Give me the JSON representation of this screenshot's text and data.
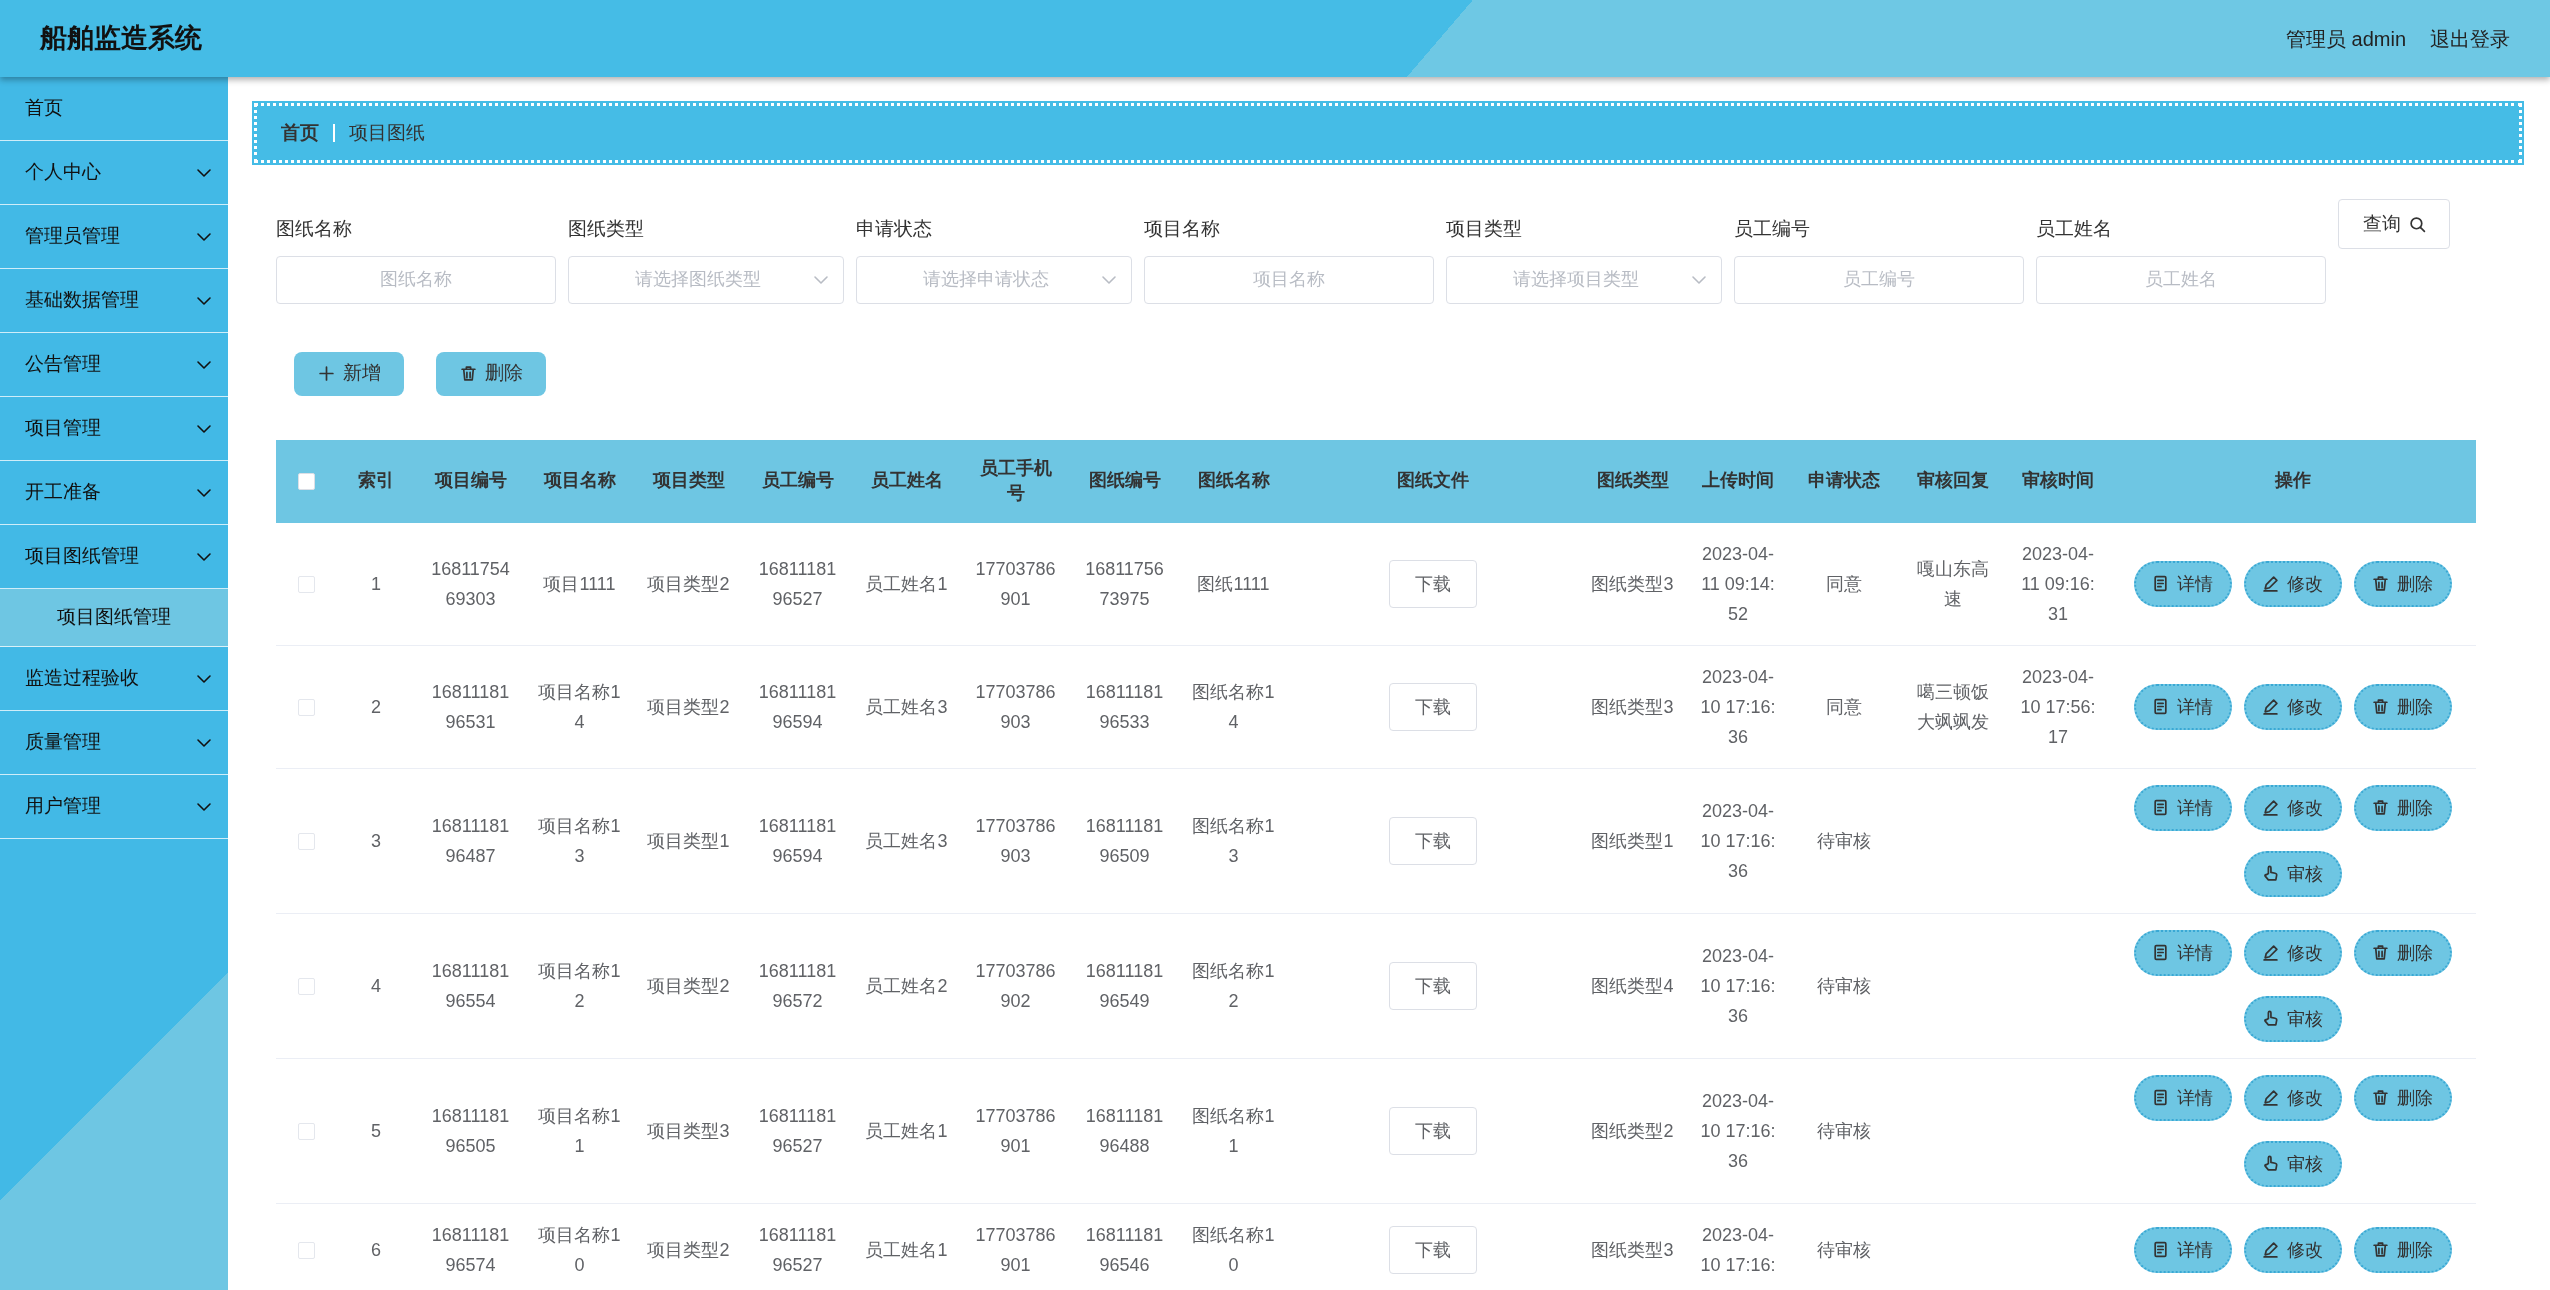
{
  "app": {
    "title": "船舶监造系统",
    "user": "管理员 admin",
    "logout": "退出登录"
  },
  "sidebar": {
    "items": [
      {
        "label": "首页",
        "kind": "link"
      },
      {
        "label": "个人中心",
        "kind": "menu"
      },
      {
        "label": "管理员管理",
        "kind": "menu"
      },
      {
        "label": "基础数据管理",
        "kind": "menu"
      },
      {
        "label": "公告管理",
        "kind": "menu"
      },
      {
        "label": "项目管理",
        "kind": "menu"
      },
      {
        "label": "开工准备",
        "kind": "menu"
      },
      {
        "label": "项目图纸管理",
        "kind": "menu",
        "children": [
          {
            "label": "项目图纸管理"
          }
        ]
      },
      {
        "label": "监造过程验收",
        "kind": "menu"
      },
      {
        "label": "质量管理",
        "kind": "menu"
      },
      {
        "label": "用户管理",
        "kind": "menu"
      }
    ]
  },
  "breadcrumb": [
    "首页",
    "项目图纸"
  ],
  "filters": [
    {
      "label": "图纸名称",
      "placeholder": "图纸名称",
      "kind": "input"
    },
    {
      "label": "图纸类型",
      "placeholder": "请选择图纸类型",
      "kind": "select"
    },
    {
      "label": "申请状态",
      "placeholder": "请选择申请状态",
      "kind": "select"
    },
    {
      "label": "项目名称",
      "placeholder": "项目名称",
      "kind": "input"
    },
    {
      "label": "项目类型",
      "placeholder": "请选择项目类型",
      "kind": "select"
    },
    {
      "label": "员工编号",
      "placeholder": "员工编号",
      "kind": "input"
    },
    {
      "label": "员工姓名",
      "placeholder": "员工姓名",
      "kind": "input"
    }
  ],
  "query_button": "查询",
  "toolbar": [
    {
      "label": "新增",
      "kind": "add"
    },
    {
      "label": "删除",
      "kind": "delete"
    }
  ],
  "table": {
    "all_checked": false,
    "columns": [
      {
        "label": "索引",
        "kind": "text"
      },
      {
        "label": "项目编号",
        "kind": "text"
      },
      {
        "label": "项目名称",
        "kind": "text"
      },
      {
        "label": "项目类型",
        "kind": "text"
      },
      {
        "label": "员工编号",
        "kind": "text"
      },
      {
        "label": "员工姓名",
        "kind": "text"
      },
      {
        "label": "员工手机号",
        "kind": "text"
      },
      {
        "label": "图纸编号",
        "kind": "text"
      },
      {
        "label": "图纸名称",
        "kind": "text"
      },
      {
        "label": "图纸文件",
        "kind": "button"
      },
      {
        "label": "图纸类型",
        "kind": "text"
      },
      {
        "label": "上传时间",
        "kind": "time"
      },
      {
        "label": "申请状态",
        "kind": "text"
      },
      {
        "label": "审核回复",
        "kind": "text"
      },
      {
        "label": "审核时间",
        "kind": "time"
      },
      {
        "label": "操作",
        "kind": "actions"
      }
    ],
    "rows": [
      {
        "checked": false,
        "cells": [
          "1",
          "1681175469303",
          "项目1111",
          "项目类型2",
          "1681118196527",
          "员工姓名1",
          "17703786901",
          "1681175673975",
          "图纸1111",
          "下载",
          "图纸类型3",
          "2023-04-11 09:14:52",
          "同意",
          "嘎山东高速",
          "2023-04-11 09:16:31",
          [
            {
              "label": "详情",
              "kind": "detail"
            },
            {
              "label": "修改",
              "kind": "edit"
            },
            {
              "label": "删除",
              "kind": "delete"
            }
          ]
        ]
      },
      {
        "checked": false,
        "cells": [
          "2",
          "1681118196531",
          "项目名称14",
          "项目类型2",
          "1681118196594",
          "员工姓名3",
          "17703786903",
          "1681118196533",
          "图纸名称14",
          "下载",
          "图纸类型3",
          "2023-04-10 17:16:36",
          "同意",
          "噶三顿饭大飒飒发",
          "2023-04-10 17:56:17",
          [
            {
              "label": "详情",
              "kind": "detail"
            },
            {
              "label": "修改",
              "kind": "edit"
            },
            {
              "label": "删除",
              "kind": "delete"
            }
          ]
        ]
      },
      {
        "checked": false,
        "cells": [
          "3",
          "1681118196487",
          "项目名称13",
          "项目类型1",
          "1681118196594",
          "员工姓名3",
          "17703786903",
          "1681118196509",
          "图纸名称13",
          "下载",
          "图纸类型1",
          "2023-04-10 17:16:36",
          "待审核",
          null,
          null,
          [
            {
              "label": "详情",
              "kind": "detail"
            },
            {
              "label": "修改",
              "kind": "edit"
            },
            {
              "label": "删除",
              "kind": "delete"
            },
            {
              "label": "审核",
              "kind": "review"
            }
          ]
        ]
      },
      {
        "checked": false,
        "cells": [
          "4",
          "1681118196554",
          "项目名称12",
          "项目类型2",
          "1681118196572",
          "员工姓名2",
          "17703786902",
          "1681118196549",
          "图纸名称12",
          "下载",
          "图纸类型4",
          "2023-04-10 17:16:36",
          "待审核",
          null,
          null,
          [
            {
              "label": "详情",
              "kind": "detail"
            },
            {
              "label": "修改",
              "kind": "edit"
            },
            {
              "label": "删除",
              "kind": "delete"
            },
            {
              "label": "审核",
              "kind": "review"
            }
          ]
        ]
      },
      {
        "checked": false,
        "cells": [
          "5",
          "1681118196505",
          "项目名称11",
          "项目类型3",
          "1681118196527",
          "员工姓名1",
          "17703786901",
          "1681118196488",
          "图纸名称11",
          "下载",
          "图纸类型2",
          "2023-04-10 17:16:36",
          "待审核",
          null,
          null,
          [
            {
              "label": "详情",
              "kind": "detail"
            },
            {
              "label": "修改",
              "kind": "edit"
            },
            {
              "label": "删除",
              "kind": "delete"
            },
            {
              "label": "审核",
              "kind": "review"
            }
          ]
        ]
      },
      {
        "checked": false,
        "cells": [
          "6",
          "1681118196574",
          "项目名称10",
          "项目类型2",
          "1681118196527",
          "员工姓名1",
          "17703786901",
          "1681118196546",
          "图纸名称10",
          "下载",
          "图纸类型3",
          "2023-04-10 17:16:",
          "待审核",
          null,
          null,
          [
            {
              "label": "详情",
              "kind": "detail"
            },
            {
              "label": "修改",
              "kind": "edit"
            },
            {
              "label": "删除",
              "kind": "delete"
            }
          ]
        ]
      }
    ]
  }
}
